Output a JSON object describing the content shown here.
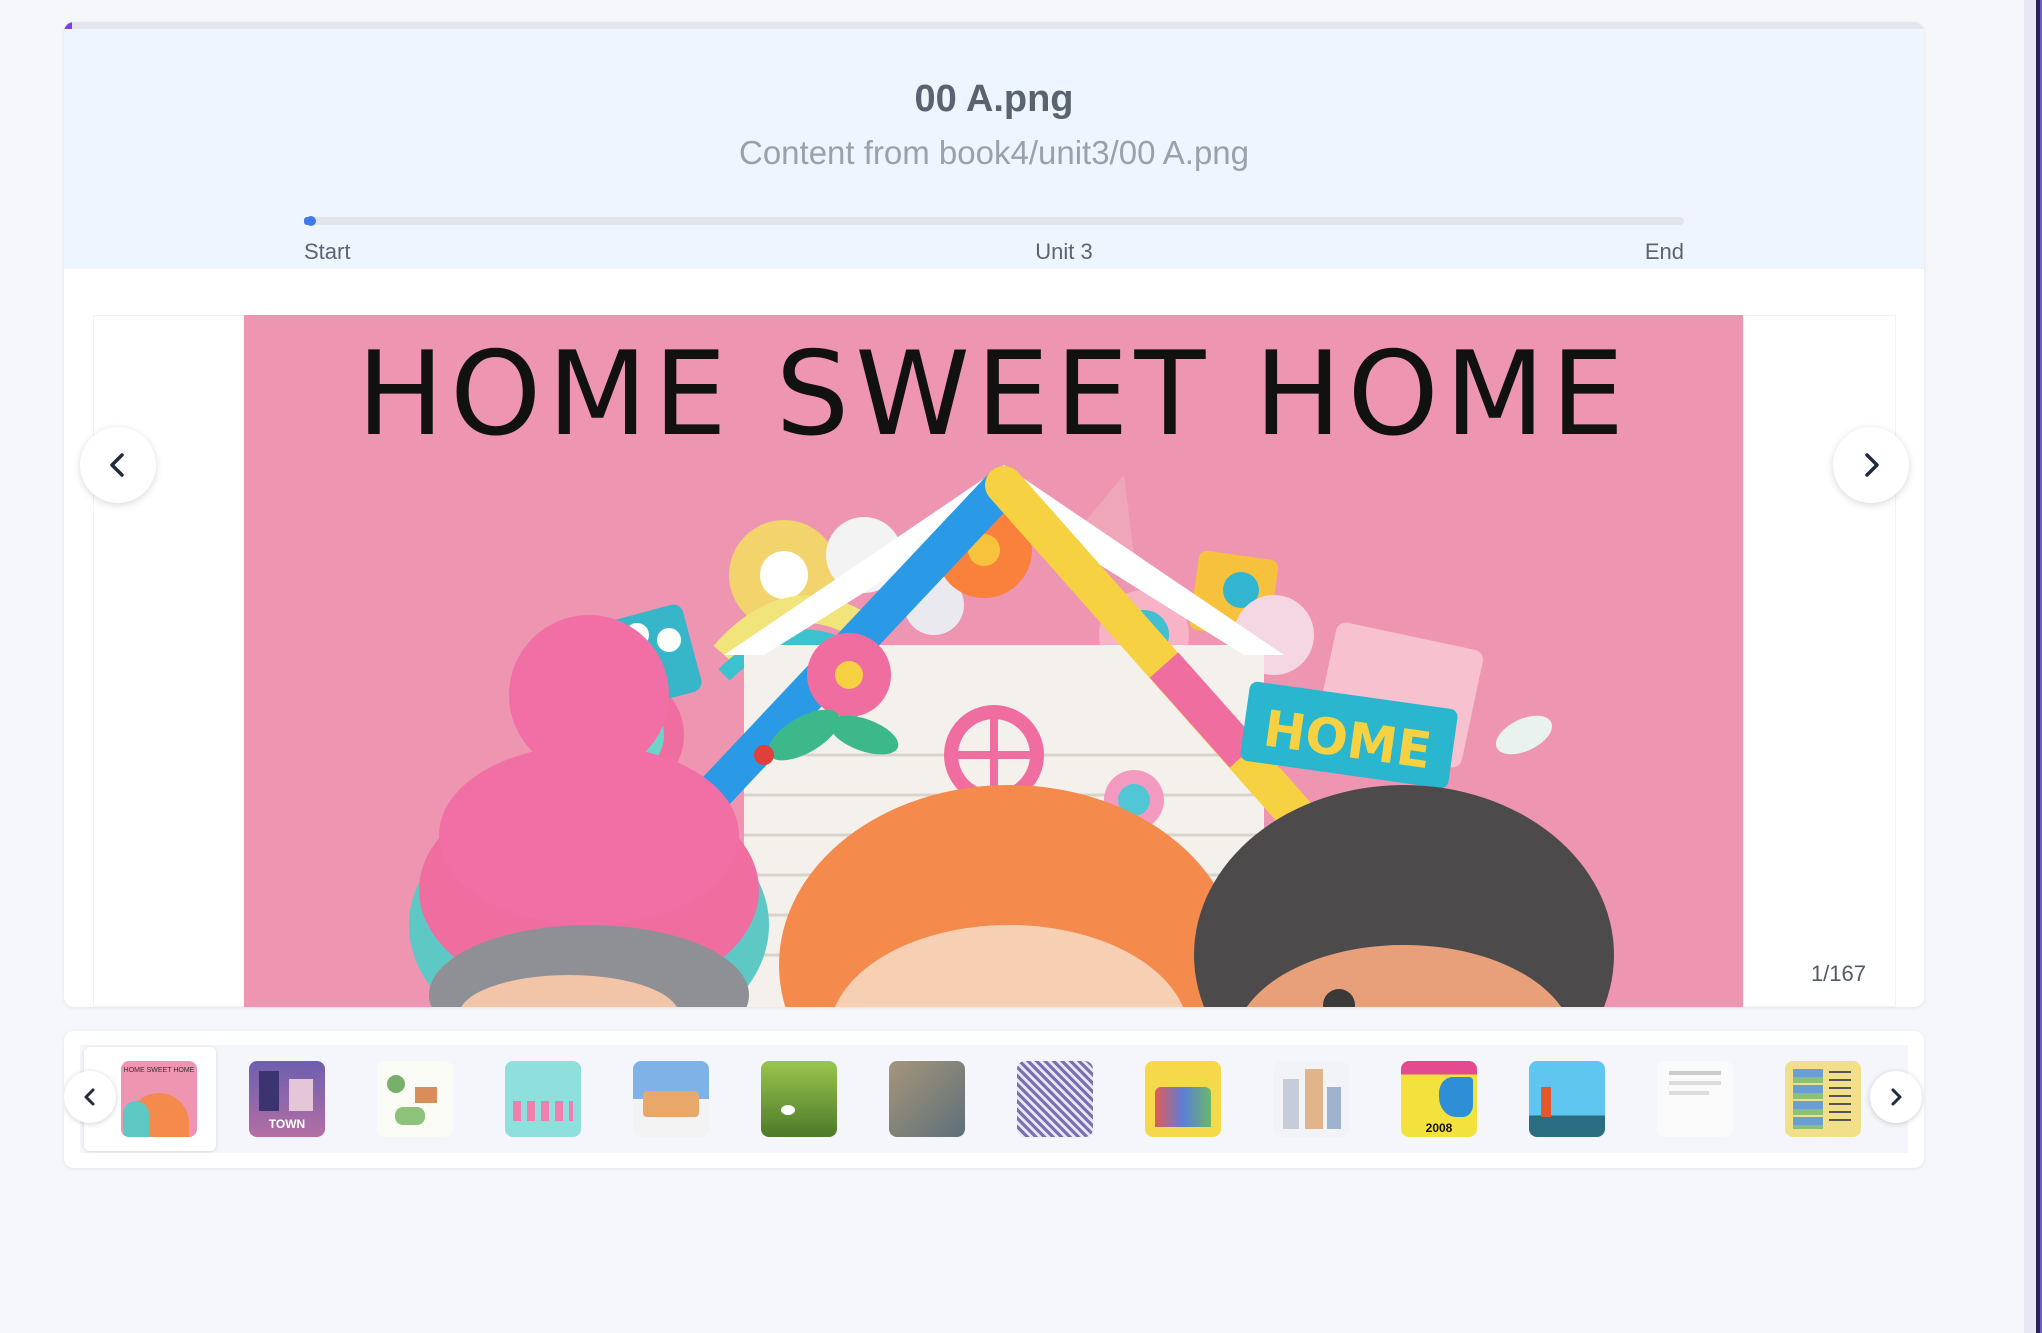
{
  "header": {
    "title": "00 A.png",
    "subtitle": "Content from book4/unit3/00 A.png"
  },
  "progress": {
    "top_fraction": 0.004,
    "unit_fraction": 0.003,
    "labels": {
      "start": "Start",
      "middle": "Unit 3",
      "end": "End"
    }
  },
  "slide": {
    "heading": "HOME SWEET HOME",
    "sign_text": "HOME",
    "counter": "1/167"
  },
  "thumbnails": {
    "items": [
      {
        "name": "thumb-home-sweet-home",
        "text": "HOME SWEET HOME"
      },
      {
        "name": "thumb-town",
        "text": "TOWN"
      },
      {
        "name": "thumb-map",
        "text": ""
      },
      {
        "name": "thumb-teal",
        "text": ""
      },
      {
        "name": "thumb-snow-village",
        "text": ""
      },
      {
        "name": "thumb-garden",
        "text": ""
      },
      {
        "name": "thumb-old-town",
        "text": ""
      },
      {
        "name": "thumb-pattern",
        "text": ""
      },
      {
        "name": "thumb-castle",
        "text": ""
      },
      {
        "name": "thumb-city",
        "text": ""
      },
      {
        "name": "thumb-chart",
        "text": "2008"
      },
      {
        "name": "thumb-blue-scene",
        "text": ""
      },
      {
        "name": "thumb-document",
        "text": ""
      },
      {
        "name": "thumb-table",
        "text": ""
      }
    ]
  },
  "colors": {
    "accent_purple": "#7b3fe4",
    "accent_blue": "#3f7be8",
    "slide_pink": "#ee95b1",
    "header_bg": "#eef5ff"
  },
  "icons": {
    "prev": "chevron-left-icon",
    "next": "chevron-right-icon"
  }
}
